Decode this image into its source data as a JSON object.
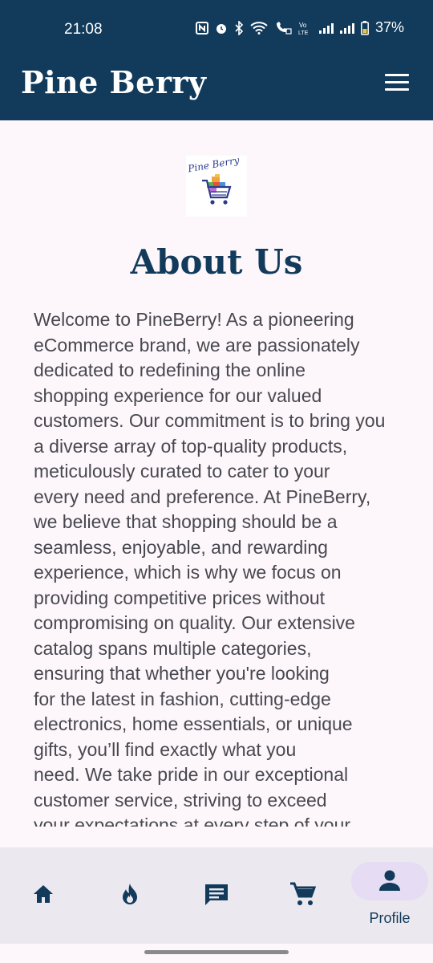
{
  "status_bar": {
    "time": "21:08",
    "battery": "37%"
  },
  "app_bar": {
    "title": "Pine Berry",
    "menu_icon": "hamburger-menu-icon"
  },
  "logo": {
    "text": "Pine Berry",
    "icon": "shopping-cart-logo"
  },
  "page": {
    "title": "About Us",
    "body": "Welcome to PineBerry! As a pioneering\neCommerce brand, we are passionately\ndedicated to redefining the online\nshopping experience for our valued\ncustomers. Our commitment is to bring you\na diverse array of top-quality products,\nmeticulously curated to cater to your\nevery need and preference. At PineBerry,\nwe believe that shopping should be a\nseamless, enjoyable, and rewarding\nexperience, which is why we focus on\nproviding competitive prices without\ncompromising on quality. Our extensive\ncatalog spans multiple categories,\nensuring that whether you're looking\nfor the latest in fashion, cutting-edge\nelectronics, home essentials, or unique\ngifts, you’ll find exactly what you\nneed. We take pride in our exceptional\ncustomer service, striving to exceed\nyour expectations at every step of your"
  },
  "bottom_nav": {
    "items": [
      {
        "icon": "home-icon"
      },
      {
        "icon": "fire-icon"
      },
      {
        "icon": "chat-icon"
      },
      {
        "icon": "cart-icon"
      },
      {
        "icon": "person-icon",
        "label": "Profile",
        "active": true
      }
    ]
  },
  "colors": {
    "primary": "#113a5b",
    "background": "#fdf7fc",
    "nav_background": "#ebe8ef",
    "active_indicator": "#e6dcf3",
    "body_text": "#48484f"
  }
}
